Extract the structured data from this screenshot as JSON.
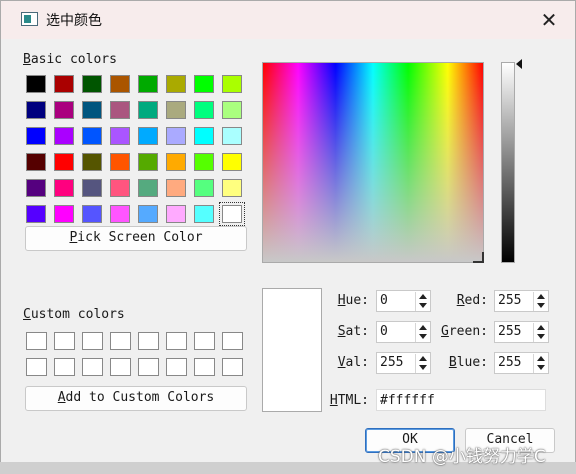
{
  "window": {
    "title": "选中颜色",
    "close_glyph": "✕"
  },
  "basic": {
    "label_u": "B",
    "label_rest": "asic colors",
    "swatches": [
      "#000000",
      "#aa0000",
      "#005500",
      "#aa5500",
      "#00aa00",
      "#aaaa00",
      "#00ff00",
      "#aaff00",
      "#00007f",
      "#aa007f",
      "#00557f",
      "#aa557f",
      "#00aa7f",
      "#aaaa7f",
      "#00ff7f",
      "#aaff7f",
      "#0000ff",
      "#aa00ff",
      "#0055ff",
      "#aa55ff",
      "#00aaff",
      "#aaaaff",
      "#00ffff",
      "#aaffff",
      "#550000",
      "#ff0000",
      "#555500",
      "#ff5500",
      "#55aa00",
      "#ffaa00",
      "#55ff00",
      "#ffff00",
      "#55007f",
      "#ff007f",
      "#55557f",
      "#ff557f",
      "#55aa7f",
      "#ffaa7f",
      "#55ff7f",
      "#ffff7f",
      "#5500ff",
      "#ff00ff",
      "#5555ff",
      "#ff55ff",
      "#55aaff",
      "#ffaaff",
      "#55ffff",
      "#ffffff"
    ],
    "selected_index": 47
  },
  "pick_screen": {
    "label_u": "P",
    "label_rest": "ick Screen Color"
  },
  "custom": {
    "label_u": "C",
    "label_rest": "ustom colors",
    "count": 16
  },
  "add_custom": {
    "label_u": "A",
    "label_rest": "dd to Custom Colors"
  },
  "fields": {
    "hue": {
      "label_u": "H",
      "label_rest": "ue:",
      "value": "0"
    },
    "sat": {
      "label_u": "S",
      "label_rest": "at:",
      "value": "0"
    },
    "val": {
      "label_u": "V",
      "label_rest": "al:",
      "value": "255"
    },
    "red": {
      "label_u": "R",
      "label_rest": "ed:",
      "value": "255"
    },
    "green": {
      "label_u": "G",
      "label_rest": "reen:",
      "value": "255"
    },
    "blue": {
      "label_u": "B",
      "label_rest": "lue:",
      "value": "255"
    },
    "html": {
      "label_u": "H",
      "label_rest": "TML:",
      "value": "#ffffff"
    }
  },
  "buttons": {
    "ok": "OK",
    "cancel": "Cancel"
  },
  "preview_color": "#ffffff",
  "watermark": "CSDN @小钱努力学C"
}
